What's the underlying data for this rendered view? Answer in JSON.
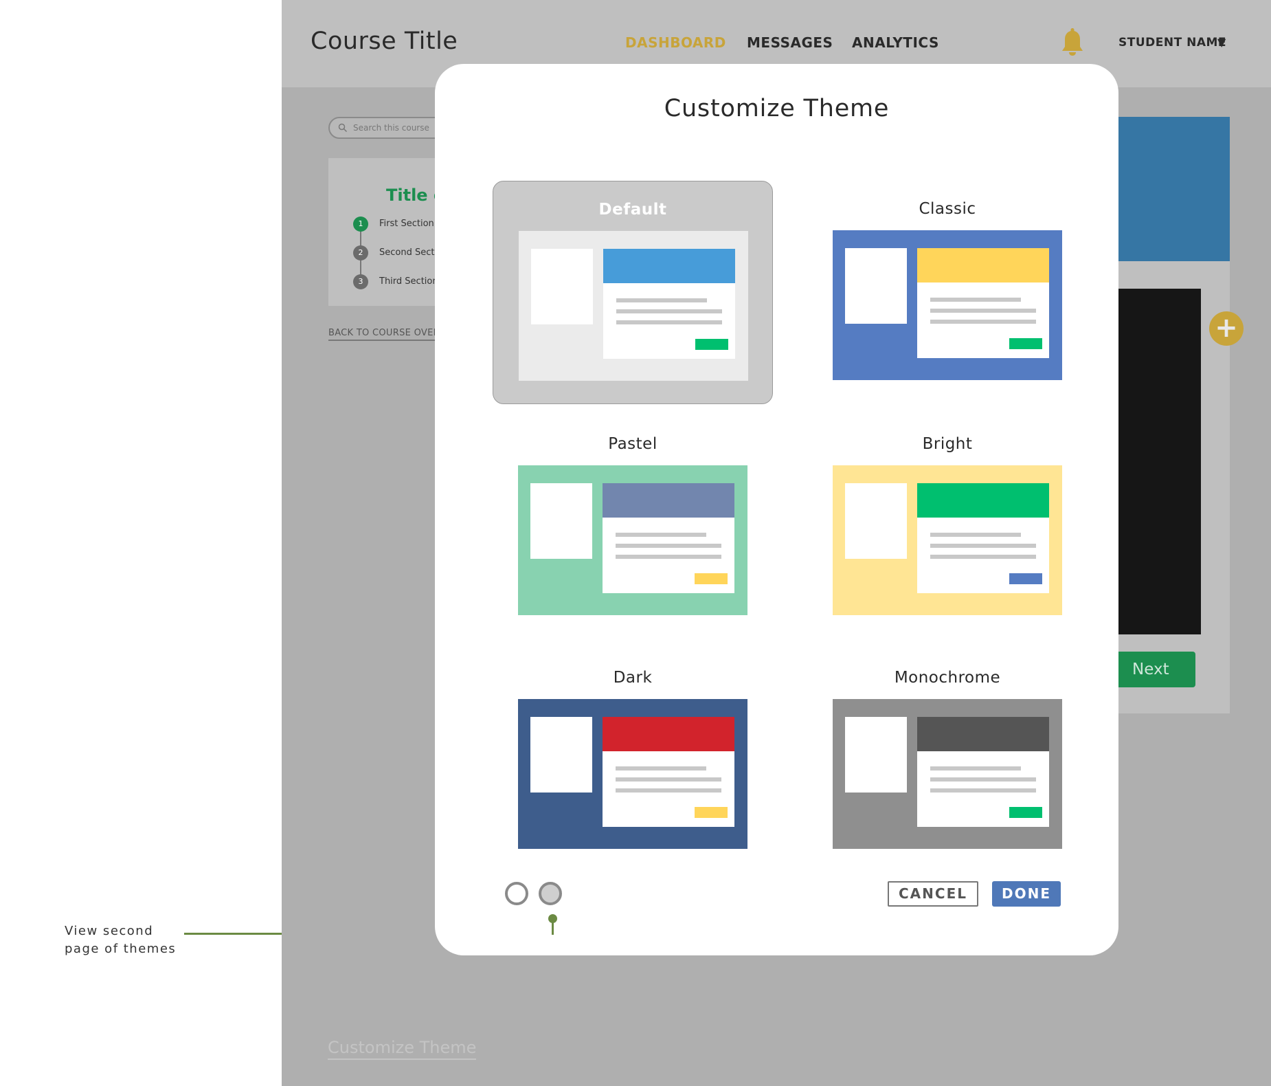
{
  "annotation": {
    "line1": "View second",
    "line2": "page of themes"
  },
  "header": {
    "course_title": "Course Title",
    "nav": [
      "DASHBOARD",
      "MESSAGES",
      "ANALYTICS"
    ],
    "active_nav": "DASHBOARD",
    "student_name": "STUDENT NAME",
    "caret": "▼"
  },
  "sidebar": {
    "search_placeholder": "Search this course",
    "outline_title": "Title o",
    "steps": [
      {
        "num": "1",
        "label": "First Section"
      },
      {
        "num": "2",
        "label": "Second Sect"
      },
      {
        "num": "3",
        "label": "Third Section"
      }
    ],
    "back_link": "BACK TO COURSE OVER"
  },
  "main": {
    "next_label": "Next",
    "plus_label": "+"
  },
  "footer_link": "Customize Theme",
  "modal": {
    "title": "Customize Theme",
    "selected_theme": "Default",
    "themes": [
      {
        "name": "Default",
        "bg": "#ebebeb",
        "head": "#479cd9",
        "btn": "#00bf6f"
      },
      {
        "name": "Classic",
        "bg": "#557cc2",
        "head": "#ffd55a",
        "btn": "#00bf6f"
      },
      {
        "name": "Pastel",
        "bg": "#88d2b0",
        "head": "#7286ae",
        "btn": "#ffd55a"
      },
      {
        "name": "Bright",
        "bg": "#ffe594",
        "head": "#00bf6f",
        "btn": "#557cc2"
      },
      {
        "name": "Dark",
        "bg": "#3e5d8c",
        "head": "#d2232c",
        "btn": "#ffd55a"
      },
      {
        "name": "Monochrome",
        "bg": "#8f8f8f",
        "head": "#555555",
        "btn": "#00bf6f"
      }
    ],
    "pages": 2,
    "current_page": 2,
    "cancel_label": "CANCEL",
    "done_label": "DONE"
  },
  "colors": {
    "accent_gold": "#c8a43a",
    "accent_green": "#1c8e4f",
    "done_blue": "#4f78b8"
  }
}
